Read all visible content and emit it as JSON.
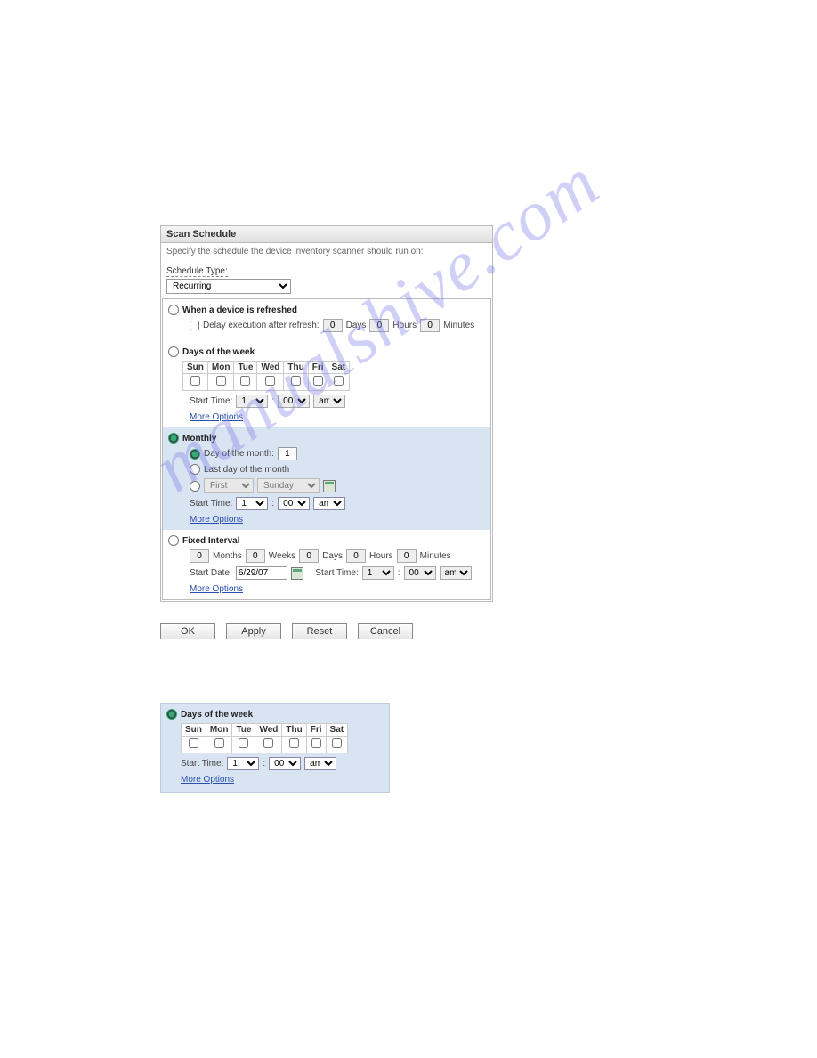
{
  "header": {
    "title": "Scan Schedule"
  },
  "description": "Specify the schedule the device inventory scanner should run on:",
  "schedule_type": {
    "label": "Schedule Type:",
    "value": "Recurring"
  },
  "sections": {
    "refresh": {
      "title": "When a device is refreshed",
      "delay_label": "Delay execution after refresh:",
      "days": "0",
      "days_label": "Days",
      "hours": "0",
      "hours_label": "Hours",
      "minutes": "0",
      "minutes_label": "Minutes"
    },
    "days_of_week": {
      "title": "Days of the week",
      "headers": [
        "Sun",
        "Mon",
        "Tue",
        "Wed",
        "Thu",
        "Fri",
        "Sat"
      ],
      "start_label": "Start Time:",
      "hour": "1",
      "minute": "00",
      "ampm": "am",
      "more": "More Options"
    },
    "monthly": {
      "title": "Monthly",
      "day_of_month_label": "Day of the month:",
      "day_of_month_value": "1",
      "last_day_label": "Last day of the month",
      "ordinal": "First",
      "weekday": "Sunday",
      "start_label": "Start Time:",
      "hour": "1",
      "minute": "00",
      "ampm": "am",
      "more": "More Options"
    },
    "fixed": {
      "title": "Fixed Interval",
      "months": "0",
      "months_label": "Months",
      "weeks": "0",
      "weeks_label": "Weeks",
      "days": "0",
      "days_label": "Days",
      "hours": "0",
      "hours_label": "Hours",
      "minutes": "0",
      "minutes_label": "Minutes",
      "start_date_label": "Start Date:",
      "start_date": "6/29/07",
      "start_time_label": "Start Time:",
      "hour": "1",
      "minute": "00",
      "ampm": "am",
      "more": "More Options"
    }
  },
  "buttons": {
    "ok": "OK",
    "apply": "Apply",
    "reset": "Reset",
    "cancel": "Cancel"
  },
  "panel2": {
    "title": "Days of the week",
    "headers": [
      "Sun",
      "Mon",
      "Tue",
      "Wed",
      "Thu",
      "Fri",
      "Sat"
    ],
    "start_label": "Start Time:",
    "hour": "1",
    "minute": "00",
    "ampm": "am",
    "more": "More Options"
  },
  "watermark": "manualshive.com"
}
